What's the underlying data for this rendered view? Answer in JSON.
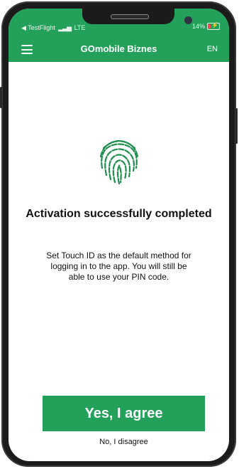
{
  "status_bar": {
    "back_app": "◀ TestFlight",
    "network": "LTE",
    "battery_percent": "14%"
  },
  "header": {
    "title": "GOmobile Biznes",
    "language": "EN"
  },
  "content": {
    "heading": "Activation successfully completed",
    "message": "Set Touch ID as the default method for logging in to the app. You will still be able to use your PIN code."
  },
  "actions": {
    "agree_label": "Yes, I agree",
    "disagree_label": "No, I disagree"
  },
  "colors": {
    "brand_green": "#23a05a",
    "fingerprint_green": "#1f8f4e"
  },
  "icons": [
    "menu-icon",
    "fingerprint-icon",
    "signal-icon",
    "battery-icon"
  ]
}
